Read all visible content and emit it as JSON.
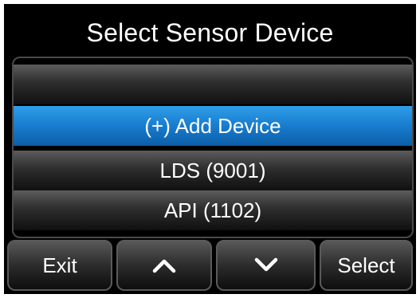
{
  "title": "Select Sensor Device",
  "list": {
    "items": [
      {
        "label": ""
      },
      {
        "label": "(+) Add Device",
        "selected": true
      },
      {
        "label": "LDS (9001)"
      },
      {
        "label": "API (1102)"
      }
    ]
  },
  "buttons": {
    "exit_label": "Exit",
    "up_icon": "chevron-up-icon",
    "down_icon": "chevron-down-icon",
    "select_label": "Select"
  },
  "colors": {
    "background": "#000000",
    "selected_row": "#1a7fd1",
    "text": "#ffffff"
  }
}
